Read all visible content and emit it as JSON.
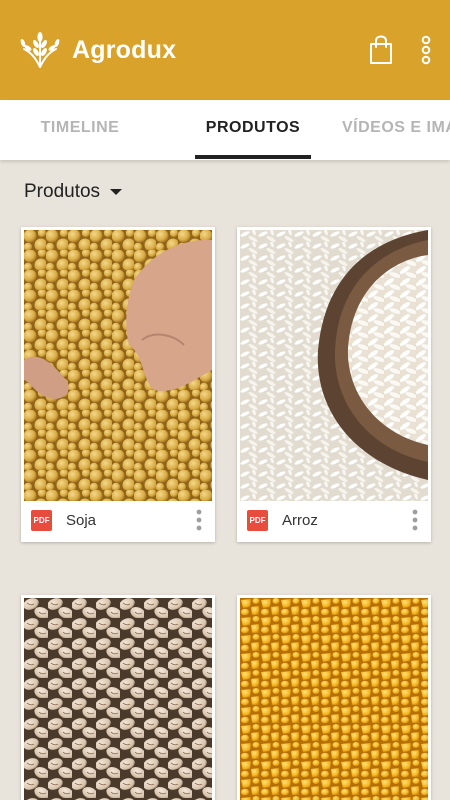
{
  "app": {
    "title": "Agrodux"
  },
  "icons": {
    "logo": "wheat-icon",
    "cart": "shopping-bag-icon",
    "menu": "more-vert-icon",
    "dropdown": "caret-down-icon",
    "file": "pdf-icon",
    "card_menu": "more-vert-icon"
  },
  "colors": {
    "primary": "#d9a22a",
    "background": "#e8e3db",
    "tab_active": "#222222",
    "tab_inactive": "#b5b5b5",
    "pdf": "#e74c3c"
  },
  "tabs": [
    {
      "label": "TIMELINE",
      "active": false
    },
    {
      "label": "PRODUTOS",
      "active": true
    },
    {
      "label": "VÍDEOS E IMA",
      "active": false
    }
  ],
  "section": {
    "title": "Produtos"
  },
  "products": [
    {
      "label": "Soja",
      "file_badge": "PDF",
      "image": "soybeans-photo"
    },
    {
      "label": "Arroz",
      "file_badge": "PDF",
      "image": "rice-photo"
    },
    {
      "label": "",
      "file_badge": "",
      "image": "beans-photo"
    },
    {
      "label": "",
      "file_badge": "",
      "image": "corn-photo"
    }
  ]
}
